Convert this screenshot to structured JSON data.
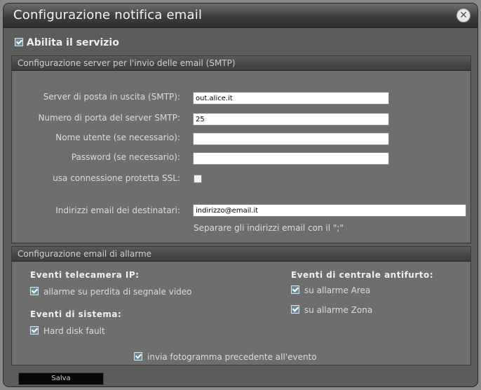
{
  "window": {
    "title": "Configurazione notifica email",
    "close_icon": "close-icon"
  },
  "enable_service": {
    "label": "Abilita il servizio",
    "checked": true
  },
  "smtp": {
    "header": "Configurazione server per l'invio delle email (SMTP)",
    "server_label": "Server di posta in uscita (SMTP):",
    "server_value": "out.alice.it",
    "port_label": "Numero di porta del server SMTP:",
    "port_value": "25",
    "user_label": "Nome utente (se necessario):",
    "user_value": "",
    "password_label": "Password (se necessario):",
    "password_value": "",
    "ssl_label": "usa connessione protetta SSL:",
    "ssl_checked": false,
    "recipients_label": "Indirizzi email dei destinatari:",
    "recipients_value": "indirizzo@email.it",
    "recipients_hint": "Separare gli indirizzi email con il \";\""
  },
  "alarm": {
    "header": "Configurazione email di allarme",
    "ipcam_title": "Eventi telecamera IP:",
    "ipcam_items": [
      {
        "label": "allarme su perdita di segnale video",
        "checked": true
      }
    ],
    "system_title": "Eventi di sistema:",
    "system_items": [
      {
        "label": "Hard disk fault",
        "checked": true
      }
    ],
    "antitheft_title": "Eventi di centrale antifurto:",
    "antitheft_items": [
      {
        "label": "su allarme Area",
        "checked": true
      },
      {
        "label": "su allarme Zona",
        "checked": true
      }
    ],
    "snapshot_label": "invia fotogramma precedente all'evento",
    "snapshot_checked": true
  },
  "save_label": "Salva"
}
